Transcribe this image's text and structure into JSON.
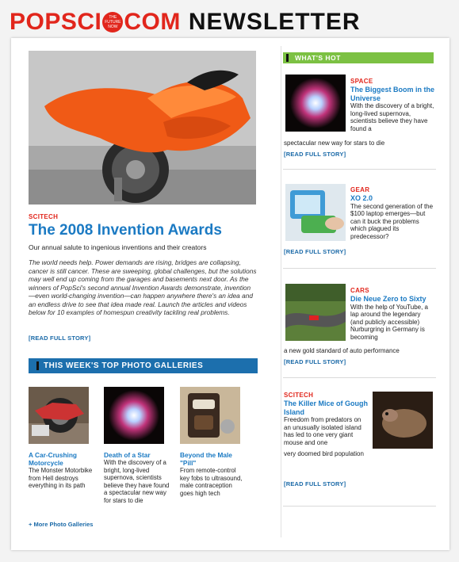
{
  "masthead": {
    "logo_left": "POPSCI",
    "logo_seal_lines": [
      "THE",
      "FUTURE",
      "NOW"
    ],
    "logo_right": "COM",
    "title": "NEWSLETTER"
  },
  "feature": {
    "category": "SCITECH",
    "headline": "The 2008 Invention Awards",
    "deck": "Our annual salute to ingenious inventions and their creators",
    "body": "The world needs help. Power demands are rising, bridges are collapsing, cancer is still cancer. These are sweeping, global challenges, but the solutions may well end up coming from the garages and basements next door. As the winners of PopSci's second annual Invention Awards demonstrate, invention—even world-changing invention—can happen anywhere there's an idea and an endless drive to see that idea made real. Launch the articles and videos below for 10 examples of homespun creativity tackling real problems.",
    "read_more": "[READ FULL STORY]"
  },
  "galleries": {
    "header": "THIS WEEK'S TOP PHOTO GALLERIES",
    "items": [
      {
        "title": "A Car-Crushing Motorcycle",
        "text": "The Monster Motorbike from Hell destroys everything in its path"
      },
      {
        "title": "Death of a Star",
        "text": "With the discovery of a bright, long-lived supernova, scientists believe they have found a spectacular new way for stars to die"
      },
      {
        "title": "Beyond the Male \"Pill\"",
        "text": "From remote-control key fobs to ultrasound, male contraception goes high tech"
      }
    ],
    "more": "+ More Photo Galleries"
  },
  "whats_hot": {
    "header": "WHAT'S HOT",
    "stories": [
      {
        "category": "SPACE",
        "headline": "The Biggest Boom in the Universe",
        "body": "With the discovery of a bright, long-lived supernova, scientists believe they have found a",
        "tail": "spectacular new way for stars to die",
        "read_more": "[READ FULL STORY]"
      },
      {
        "category": "GEAR",
        "headline": "XO 2.0",
        "body": "The second generation of the $100 laptop emerges—but can it buck the problems which plagued its predecessor?",
        "tail": "",
        "read_more": "[READ FULL STORY]"
      },
      {
        "category": "CARS",
        "headline": "Die Neue Zero to Sixty",
        "body": "With the help of YouTube, a lap around the legendary (and publicly accessible) Nurburgring in Germany is becoming",
        "tail": "a new gold standard of auto performance",
        "read_more": "[READ FULL STORY]"
      },
      {
        "category": "SCITECH",
        "headline": "The Killer Mice of Gough Island",
        "body": "Freedom from predators on an unusually isolated island has led to one very giant mouse and one",
        "tail": "very doomed bird population",
        "read_more": "[READ FULL STORY]"
      }
    ]
  },
  "colors": {
    "brand_red": "#e1261c",
    "link_blue": "#1b7ac3",
    "section_blue": "#1c6fad",
    "hot_green": "#7cc143"
  }
}
